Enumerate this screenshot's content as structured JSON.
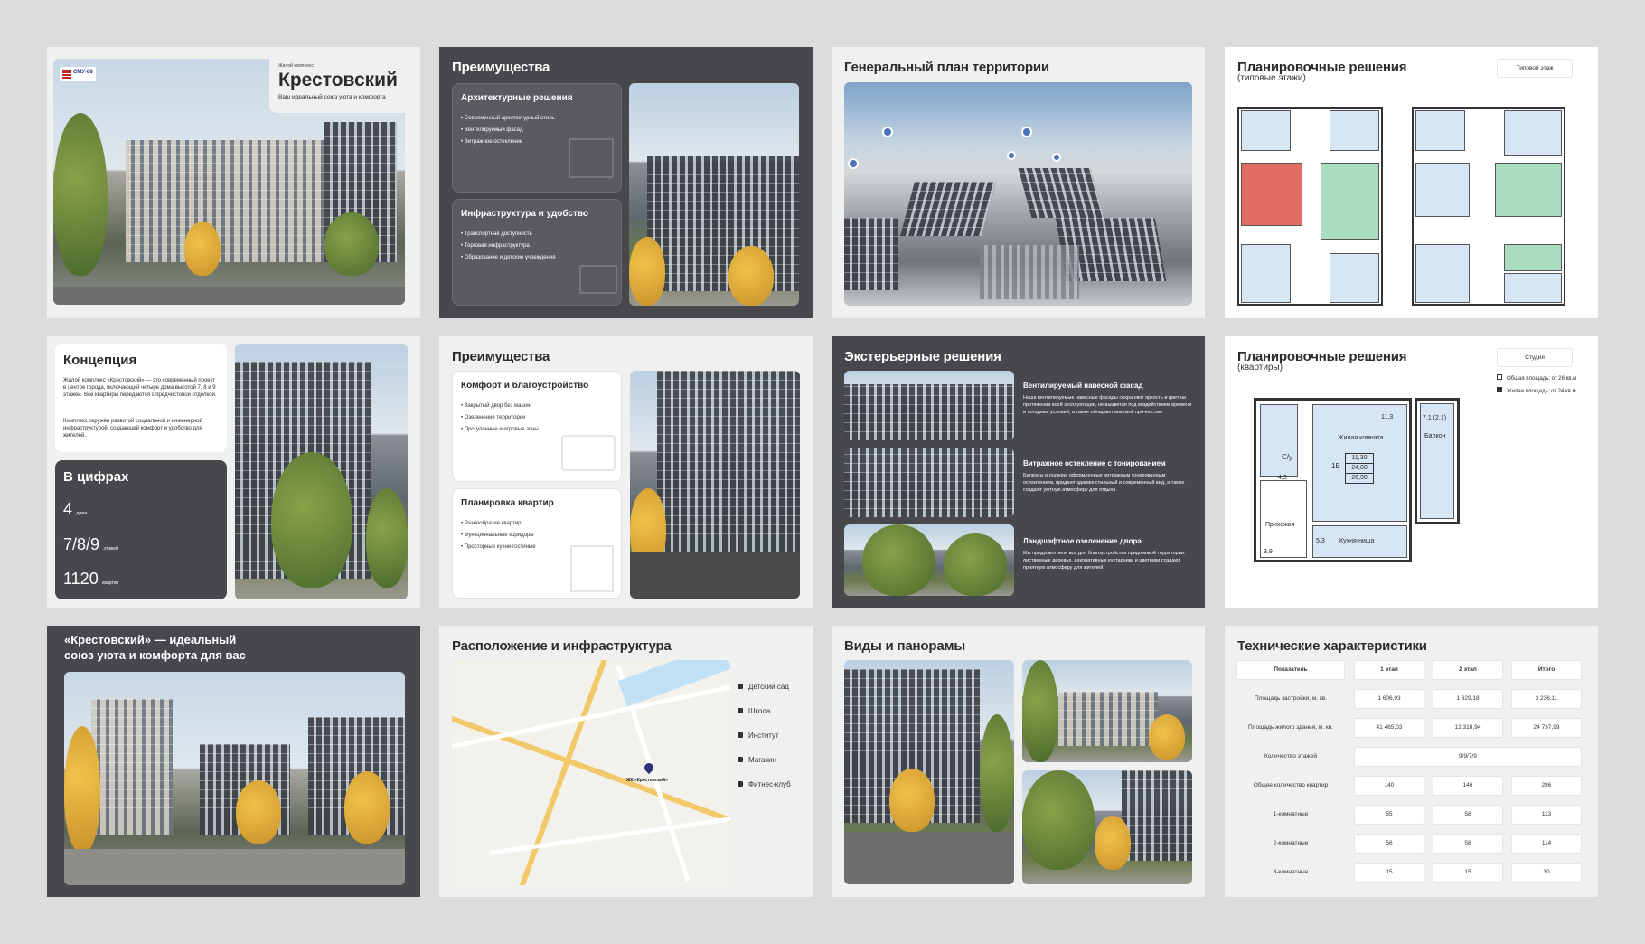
{
  "s1": {
    "complex_label": "Жилой комплекс",
    "title": "Крестовский",
    "tagline": "Ваш идеальный союз уюта и комфорта",
    "logo_text": "СМУ-88"
  },
  "s2": {
    "title": "Преимущества",
    "card1": {
      "title": "Архитектурные решения",
      "items": [
        "Современный архитектурный стиль",
        "Вентилируемый фасад",
        "Витражное остекление"
      ]
    },
    "card2": {
      "title": "Инфраструктура и удобство",
      "items": [
        "Транспортная доступность",
        "Торговая инфраструктура",
        "Образование и детские учреждения"
      ]
    }
  },
  "s3": {
    "title": "Генеральный план территории"
  },
  "s4": {
    "title": "Планировочные решения",
    "subtitle": "(типовые этажи)",
    "tag": "Типовой этаж"
  },
  "s5": {
    "title": "Концепция",
    "text1": "Жилой комплекс «Крестовский» — это современный проект в центре города, включающий четыре дома высотой 7, 8 и 9 этажей. Все квартиры передаются с предчистовой отделкой.",
    "text2": "Комплекс окружён развитой социальной и инженерной инфраструктурой, создающей комфорт и удобство для жителей.",
    "numbers_title": "В цифрах",
    "stats": [
      {
        "value": "4",
        "unit": "дома"
      },
      {
        "value": "7/8/9",
        "unit": "этажей"
      },
      {
        "value": "1120",
        "unit": "квартир"
      }
    ]
  },
  "s6": {
    "title": "Преимущества",
    "card1": {
      "title": "Комфорт и благоустройство",
      "items": [
        "Закрытый двор без машин",
        "Озеленение территории",
        "Прогулочные и игровые зоны"
      ]
    },
    "card2": {
      "title": "Планировка квартир",
      "items": [
        "Разнообразие квартир",
        "Функциональные коридоры",
        "Просторные кухни-гостиные"
      ]
    }
  },
  "s7": {
    "title": "Экстерьерные решения",
    "items": [
      {
        "title": "Вентилируемый навесной фасад",
        "text": "Наши вентилируемые навесные фасады сохраняют яркость и цвет на протяжении всей эксплуатации, не выцветая под воздействием времени и погодных условий, а также обладают высокой прочностью"
      },
      {
        "title": "Витражное остекление с тонированием",
        "text": "Балконы и лоджии, оформленные витражным тонированным остеклением, придают зданию стильный и современный вид, а также создают уютную атмосферу для отдыха"
      },
      {
        "title": "Ландшафтное озеленение двора",
        "text": "Мы предусмотрели все для благоустройства придомовой территории: лиственные деревья, декоративные кустарники и цветники создают приятную атмосферу для жителей"
      }
    ]
  },
  "s8": {
    "title": "Планировочные решения",
    "subtitle": "(квартиры)",
    "tag": "Студия",
    "legend1": "Общая площадь: от 26 кв.м",
    "legend2": "Жилая площадь: от 24 кв.м",
    "labels": {
      "cy": "С/у",
      "cy_area": "4,3",
      "hall": "Прихожая",
      "hall_area": "3,9",
      "living": "Жилая комната",
      "living_area": "11,3",
      "apt": "1В",
      "a1": "11,30",
      "a2": "24,80",
      "a3": "26,90",
      "kitchen": "Кухня-ниша",
      "kitchen_area": "5,3",
      "balcony_area": "7,1 (2,1)",
      "balcony": "Балкон"
    }
  },
  "s9": {
    "title_line1": "«Крестовский» — идеальный",
    "title_line2": "союз уюта и комфорта для вас"
  },
  "s10": {
    "title": "Расположение и инфраструктура",
    "legend": [
      "Детский сад",
      "Школа",
      "Институт",
      "Магазин",
      "Фитнес-клуб"
    ],
    "marker": "ЖК «Крестовский»"
  },
  "s11": {
    "title": "Виды и панорамы"
  },
  "s12": {
    "title": "Технические характеристики",
    "headers": [
      "Показатель",
      "1 этап",
      "2 этап",
      "Итого"
    ],
    "rows": [
      {
        "label": "Площадь застройки, м. кв.",
        "v1": "1 606,93",
        "v2": "1 629,18",
        "v3": "3 236,11"
      },
      {
        "label": "Площадь жилого здания, м. кв.",
        "v1": "41 465,03",
        "v2": "12 318,94",
        "v3": "24 737,99"
      },
      {
        "label": "Количество этажей",
        "v1": "9/9/7/9",
        "v2": "",
        "v3": ""
      },
      {
        "label": "Общее количество квартир",
        "v1": "140",
        "v2": "146",
        "v3": "286"
      },
      {
        "label": "1-комнатные",
        "v1": "55",
        "v2": "58",
        "v3": "113"
      },
      {
        "label": "2-комнатные",
        "v1": "56",
        "v2": "58",
        "v3": "114"
      },
      {
        "label": "3-комнатные",
        "v1": "15",
        "v2": "15",
        "v3": "30"
      }
    ]
  }
}
